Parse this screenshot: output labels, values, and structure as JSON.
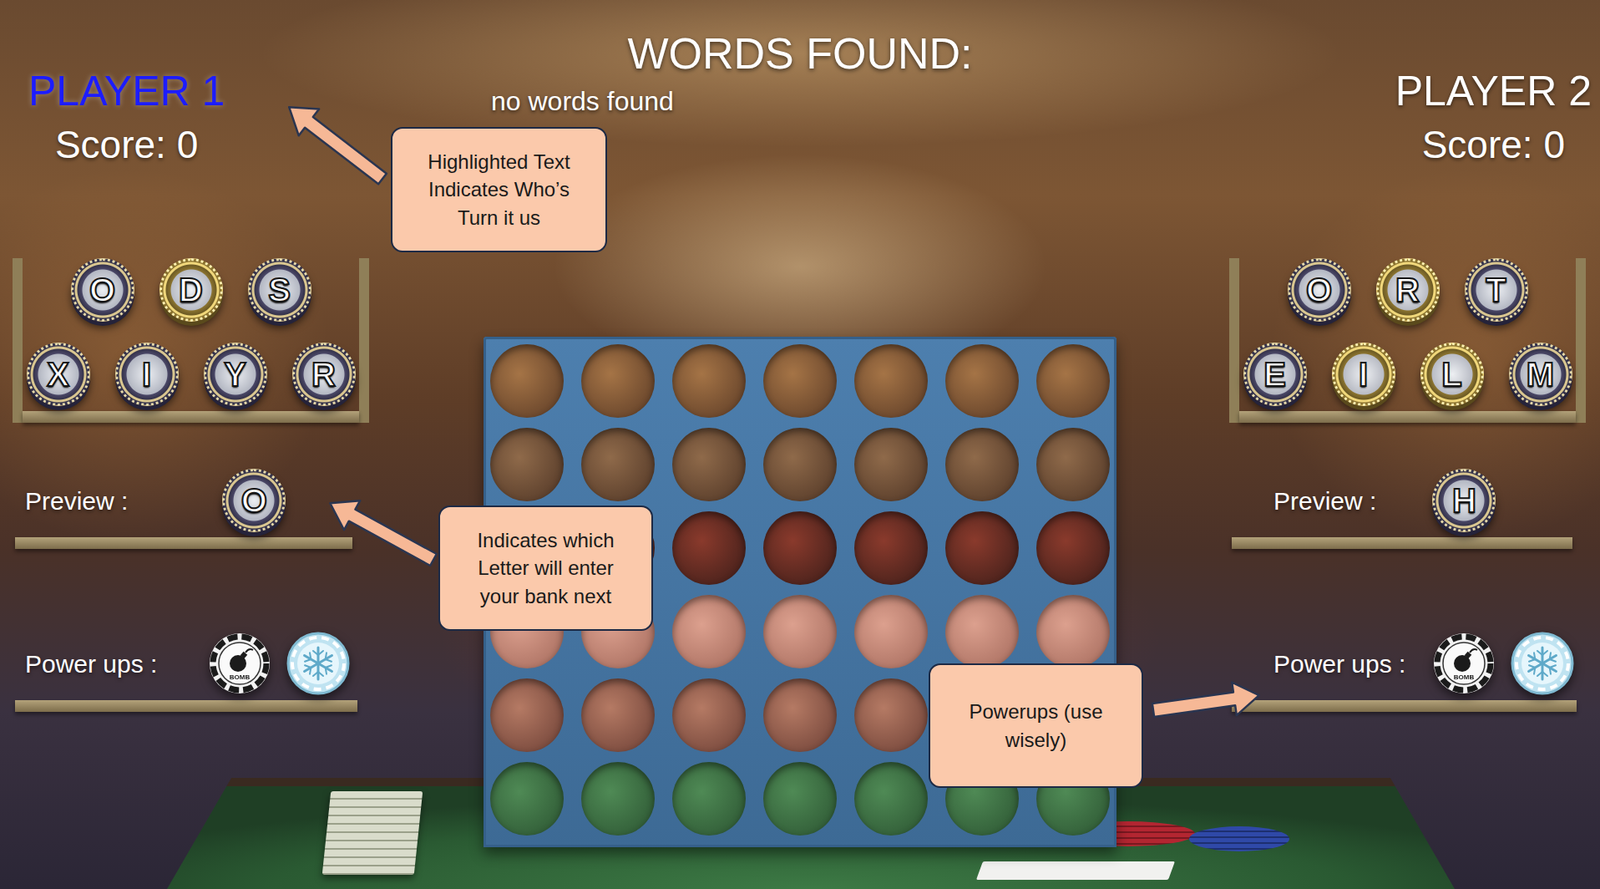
{
  "header": {
    "title": "WORDS FOUND:",
    "words": [],
    "empty_text": "no words found"
  },
  "players": [
    {
      "name": "PLAYER 1",
      "active": true,
      "score_label": "Score:",
      "score": "0",
      "bank": [
        [
          {
            "letter": "O",
            "gold": false
          },
          {
            "letter": "D",
            "gold": true
          },
          {
            "letter": "S",
            "gold": false
          }
        ],
        [
          {
            "letter": "X",
            "gold": false
          },
          {
            "letter": "I",
            "gold": false
          },
          {
            "letter": "Y",
            "gold": false
          },
          {
            "letter": "R",
            "gold": false
          }
        ]
      ],
      "preview_label": "Preview :",
      "preview": {
        "letter": "O",
        "gold": false
      },
      "powerups_label": "Power ups :",
      "powerups": [
        {
          "kind": "bomb",
          "label": "BOMB"
        },
        {
          "kind": "freeze",
          "label": ""
        }
      ]
    },
    {
      "name": "PLAYER 2",
      "active": false,
      "score_label": "Score:",
      "score": "0",
      "bank": [
        [
          {
            "letter": "O",
            "gold": false
          },
          {
            "letter": "R",
            "gold": true
          },
          {
            "letter": "T",
            "gold": false
          }
        ],
        [
          {
            "letter": "E",
            "gold": false
          },
          {
            "letter": "I",
            "gold": true
          },
          {
            "letter": "L",
            "gold": true
          },
          {
            "letter": "M",
            "gold": false
          }
        ]
      ],
      "preview_label": "Preview :",
      "preview": {
        "letter": "H",
        "gold": false
      },
      "powerups_label": "Power ups :",
      "powerups": [
        {
          "kind": "bomb",
          "label": "BOMB"
        },
        {
          "kind": "freeze",
          "label": ""
        }
      ]
    }
  ],
  "board": {
    "rows": [
      [
        0,
        0,
        0,
        0,
        0,
        0,
        0
      ],
      [
        0,
        0,
        0,
        0,
        0,
        0,
        0
      ],
      [
        0,
        0,
        0,
        0,
        0,
        0,
        0
      ],
      [
        0,
        0,
        0,
        0,
        0,
        0,
        0
      ],
      [
        0,
        0,
        0,
        0,
        0,
        0,
        0
      ],
      [
        0,
        0,
        0,
        0,
        0,
        0,
        0
      ]
    ]
  },
  "callouts": [
    {
      "target": "turn",
      "text": "Highlighted Text Indicates Who’s Turn it us"
    },
    {
      "target": "preview",
      "text": "Indicates which Letter will enter your bank next"
    },
    {
      "target": "powerups",
      "text": "Powerups (use wisely)"
    }
  ]
}
